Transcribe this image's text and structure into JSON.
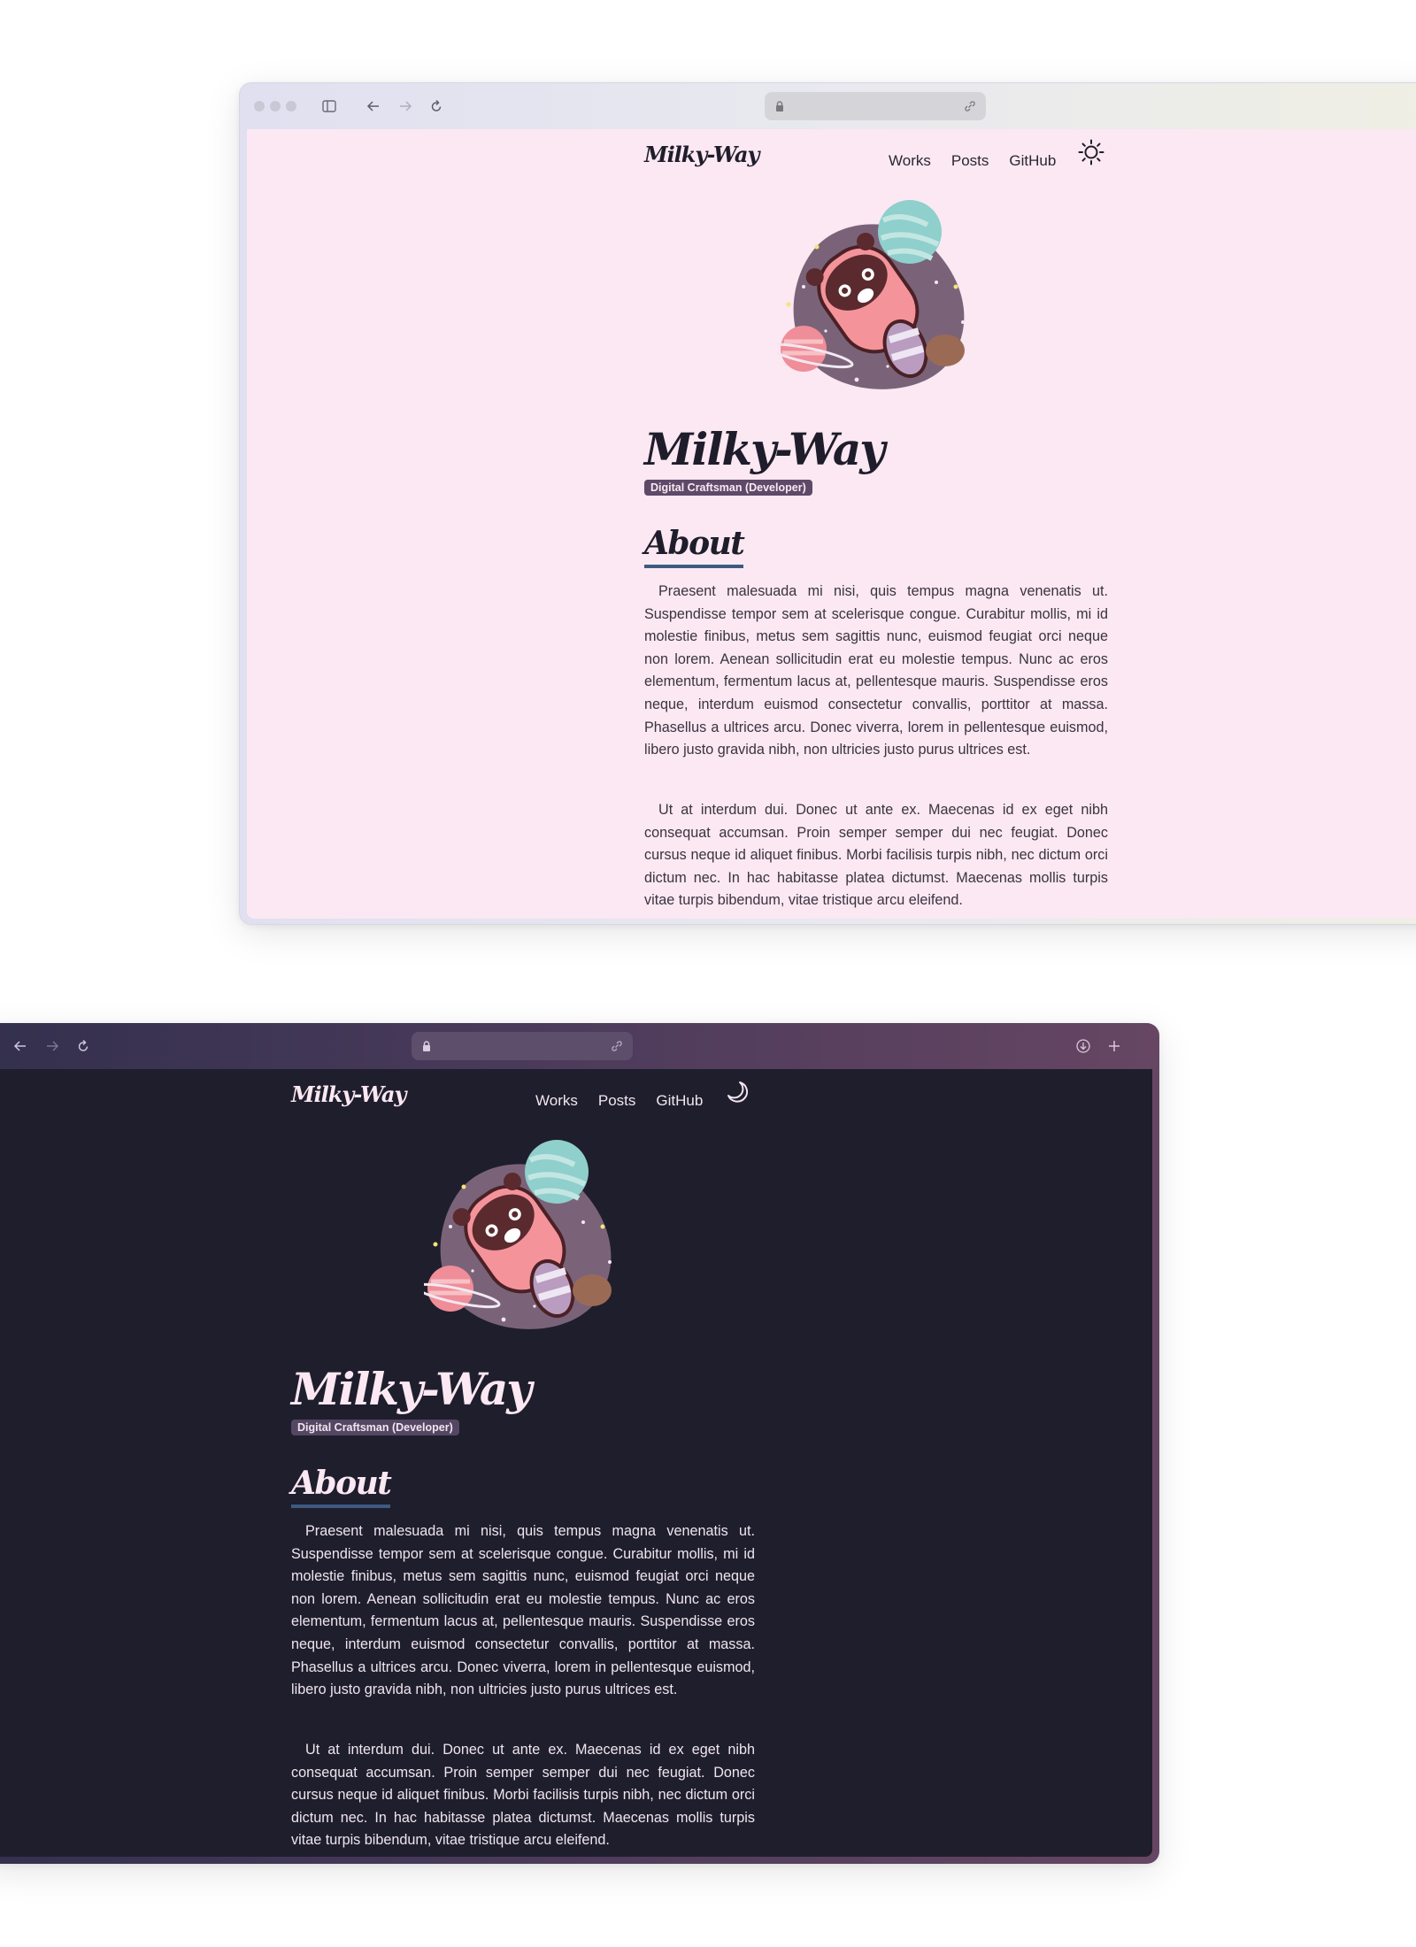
{
  "colors": {
    "light_bg": "#fbe8f2",
    "dark_bg": "#1f1e2d",
    "accent_underline": "#3d5a80",
    "badge_light": "#5d4a68",
    "badge_dark": "#544763"
  },
  "windows": [
    {
      "theme": "light",
      "toolbar": {
        "icons": [
          "traffic-lights",
          "sidebar-icon",
          "back-arrow-icon",
          "forward-arrow-icon",
          "reload-icon",
          "lock-icon",
          "link-icon"
        ]
      },
      "site": {
        "logo": "Milky-Way",
        "nav": [
          "Works",
          "Posts",
          "GitHub"
        ],
        "theme_toggle_icon": "sun-icon",
        "title": "Milky-Way",
        "badge": "Digital Craftsman (Developer)",
        "section_heading": "About",
        "paragraphs": [
          "Praesent malesuada mi nisi, quis tempus magna venenatis ut. Suspendisse tempor sem at scelerisque congue. Curabitur mollis, mi id molestie finibus, metus sem sagittis nunc, euismod feugiat orci neque non lorem. Aenean sollicitudin erat eu molestie tempus. Nunc ac eros elementum, fermentum lacus at, pellentesque mauris. Suspendisse eros neque, interdum euismod consectetur convallis, porttitor at massa. Phasellus a ultrices arcu. Donec viverra, lorem in pellentesque euismod, libero justo gravida nibh, non ultricies justo purus ultrices est.",
          "Ut at interdum dui. Donec ut ante ex. Maecenas id ex eget nibh consequat accumsan. Proin semper semper dui nec feugiat. Donec cursus neque id aliquet finibus. Morbi facilisis turpis nibh, nec dictum orci dictum nec. In hac habitasse platea dictumst. Maecenas mollis turpis vitae turpis bibendum, vitae tristique arcu eleifend."
        ]
      }
    },
    {
      "theme": "dark",
      "toolbar": {
        "icons": [
          "back-arrow-icon",
          "forward-arrow-icon",
          "reload-icon",
          "lock-icon",
          "link-icon",
          "download-icon",
          "new-tab-icon"
        ]
      },
      "site": {
        "logo": "Milky-Way",
        "nav": [
          "Works",
          "Posts",
          "GitHub"
        ],
        "theme_toggle_icon": "moon-icon",
        "title": "Milky-Way",
        "badge": "Digital Craftsman (Developer)",
        "section_heading": "About",
        "paragraphs": [
          "Praesent malesuada mi nisi, quis tempus magna venenatis ut. Suspendisse tempor sem at scelerisque congue. Curabitur mollis, mi id molestie finibus, metus sem sagittis nunc, euismod feugiat orci neque non lorem. Aenean sollicitudin erat eu molestie tempus. Nunc ac eros elementum, fermentum lacus at, pellentesque mauris. Suspendisse eros neque, interdum euismod consectetur convallis, porttitor at massa. Phasellus a ultrices arcu. Donec viverra, lorem in pellentesque euismod, libero justo gravida nibh, non ultricies justo purus ultrices est.",
          "Ut at interdum dui. Donec ut ante ex. Maecenas id ex eget nibh consequat accumsan. Proin semper semper dui nec feugiat. Donec cursus neque id aliquet finibus. Morbi facilisis turpis nibh, nec dictum orci dictum nec. In hac habitasse platea dictumst. Maecenas mollis turpis vitae turpis bibendum, vitae tristique arcu eleifend."
        ]
      }
    }
  ]
}
